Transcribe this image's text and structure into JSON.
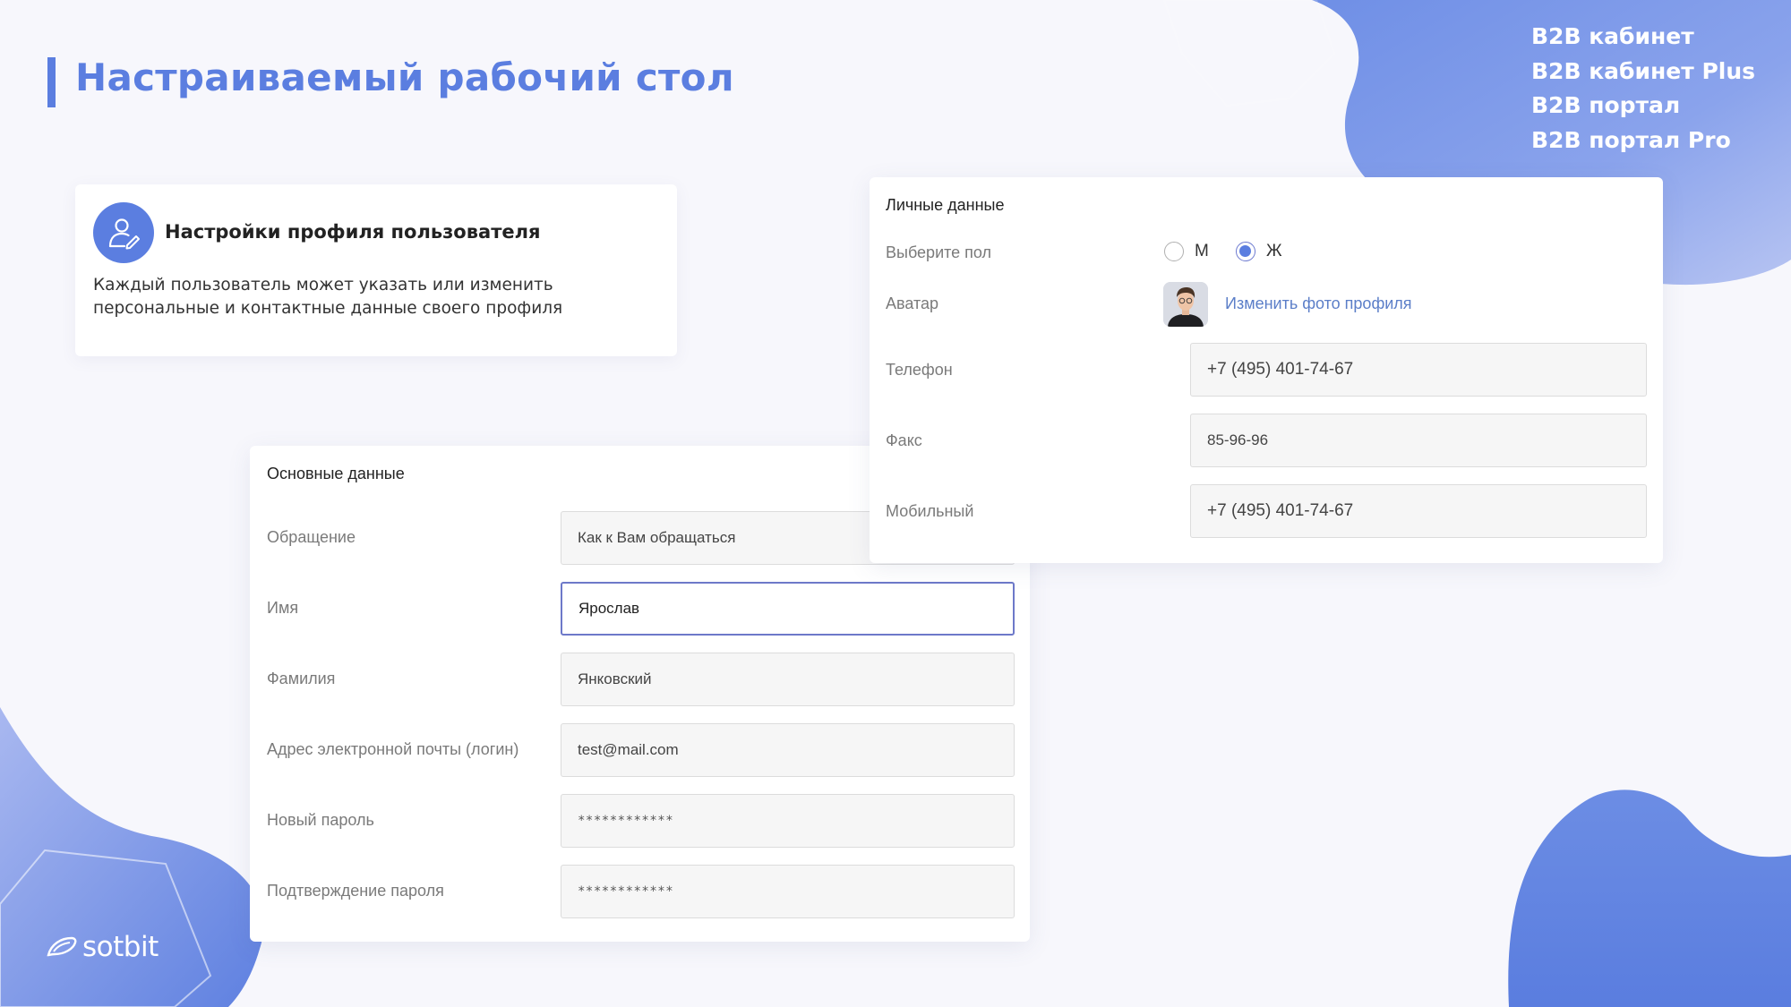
{
  "header": {
    "title": "Настраиваемый рабочий стол",
    "products": [
      "B2B кабинет",
      "B2B кабинет Plus",
      "B2B портал",
      "B2B портал Pro"
    ]
  },
  "info_card": {
    "icon": "user-edit-icon",
    "title": "Настройки профиля пользователя",
    "text": "Каждый пользователь может указать или изменить персональные и контактные данные своего профиля"
  },
  "main_form": {
    "title": "Основные данные",
    "fields": [
      {
        "label": "Обращение",
        "value": "Как к Вам обращаться"
      },
      {
        "label": "Имя",
        "value": "Ярослав"
      },
      {
        "label": "Фамилия",
        "value": "Янковский"
      },
      {
        "label": "Адрес электронной почты (логин)",
        "value": "test@mail.com"
      },
      {
        "label": "Новый пароль",
        "value": "************"
      },
      {
        "label": "Подтверждение пароля",
        "value": "************"
      }
    ]
  },
  "personal_form": {
    "title": "Личные данные",
    "gender_label": "Выберите пол",
    "gender_options": [
      {
        "label": "М",
        "selected": false
      },
      {
        "label": "Ж",
        "selected": true
      }
    ],
    "avatar_label": "Аватар",
    "change_photo_link": "Изменить фото профиля",
    "fields": [
      {
        "label": "Телефон",
        "value": "+7 (495) 401-74-67"
      },
      {
        "label": "Факс",
        "value": "85-96-96"
      },
      {
        "label": "Мобильный",
        "value": "+7 (495) 401-74-67"
      }
    ]
  },
  "logo": {
    "text": "sotbit"
  },
  "colors": {
    "accent": "#5b7ee0",
    "background": "#f7f7fc",
    "link": "#5b7ec8",
    "focus_border": "#6d79c9"
  }
}
